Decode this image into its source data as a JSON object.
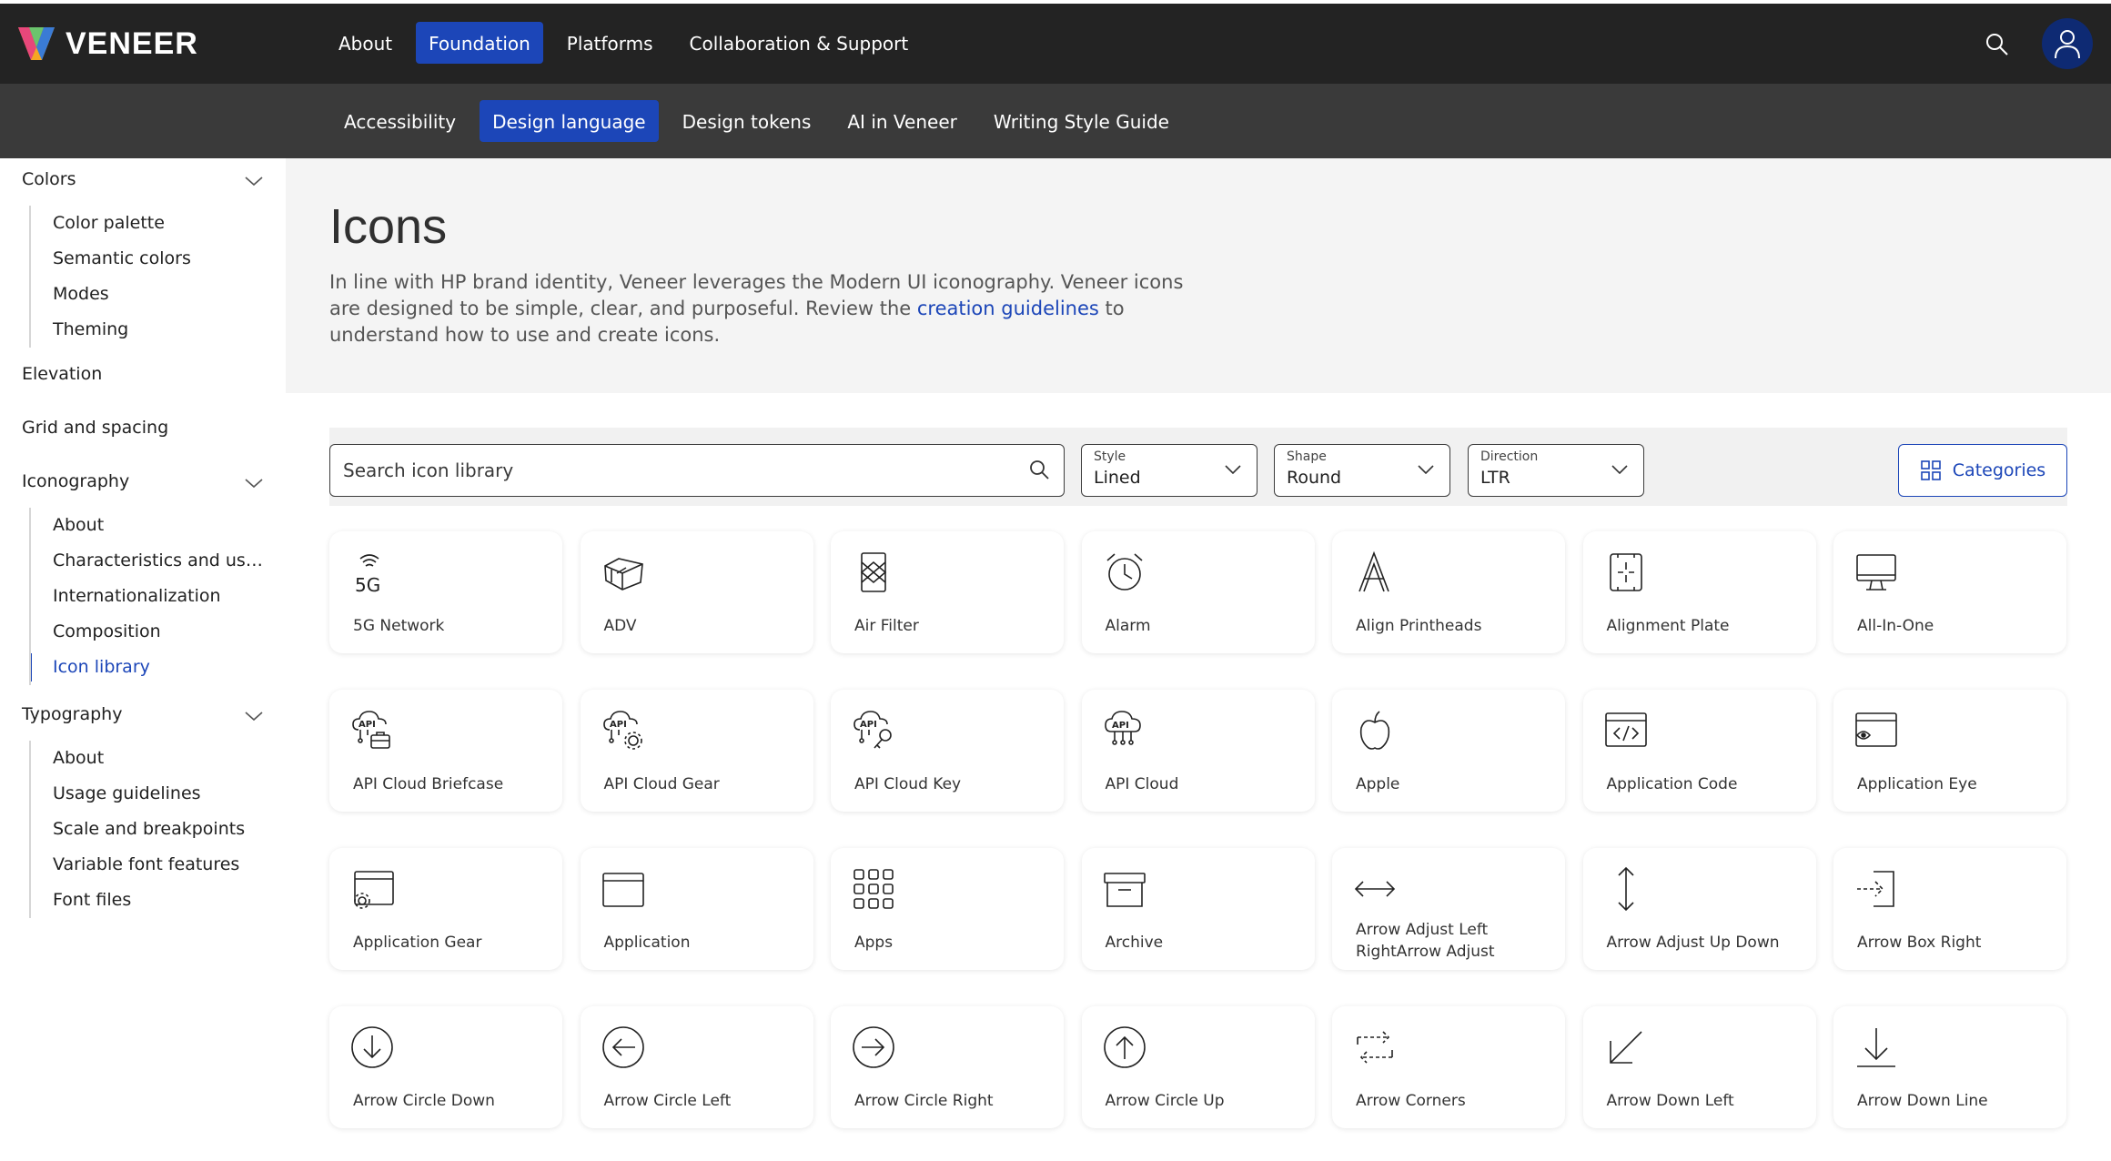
{
  "brand": {
    "name": "VENEER"
  },
  "main_nav": [
    {
      "label": "About",
      "active": false
    },
    {
      "label": "Foundation",
      "active": true
    },
    {
      "label": "Platforms",
      "active": false
    },
    {
      "label": "Collaboration & Support",
      "active": false
    }
  ],
  "sub_nav": [
    {
      "label": "Accessibility",
      "active": false
    },
    {
      "label": "Design language",
      "active": true
    },
    {
      "label": "Design tokens",
      "active": false
    },
    {
      "label": "AI in Veneer",
      "active": false
    },
    {
      "label": "Writing Style Guide",
      "active": false
    }
  ],
  "sidebar": {
    "colors": {
      "label": "Colors",
      "items": [
        "Color palette",
        "Semantic colors",
        "Modes",
        "Theming"
      ]
    },
    "elevation": {
      "label": "Elevation"
    },
    "grid": {
      "label": "Grid and spacing"
    },
    "iconography": {
      "label": "Iconography",
      "items": [
        "About",
        "Characteristics and usage",
        "Internationalization",
        "Composition",
        "Icon library"
      ],
      "active_item": "Icon library"
    },
    "typography": {
      "label": "Typography",
      "items": [
        "About",
        "Usage guidelines",
        "Scale and breakpoints",
        "Variable font features",
        "Font files"
      ]
    }
  },
  "page": {
    "title": "Icons",
    "desc_before": "In line with HP brand identity, Veneer leverages the Modern UI iconography. Veneer icons are designed to be simple, clear, and purposeful. Review the ",
    "desc_link": "creation guidelines",
    "desc_after": " to understand how to use and create icons."
  },
  "toolbar": {
    "search_placeholder": "Search icon library",
    "style": {
      "label": "Style",
      "value": "Lined"
    },
    "shape": {
      "label": "Shape",
      "value": "Round"
    },
    "direction": {
      "label": "Direction",
      "value": "LTR"
    },
    "categories_label": "Categories"
  },
  "colors": {
    "topbar": "#232323",
    "subbar": "#3a3a3a",
    "accent": "#1c46b8"
  },
  "icons": [
    {
      "name": "5G Network",
      "icon": "5g-network-icon"
    },
    {
      "name": "ADV",
      "icon": "adv-icon"
    },
    {
      "name": "Air Filter",
      "icon": "air-filter-icon"
    },
    {
      "name": "Alarm",
      "icon": "alarm-icon"
    },
    {
      "name": "Align Printheads",
      "icon": "align-printheads-icon"
    },
    {
      "name": "Alignment Plate",
      "icon": "alignment-plate-icon"
    },
    {
      "name": "All-In-One",
      "icon": "all-in-one-icon"
    },
    {
      "name": "API Cloud Briefcase",
      "icon": "api-cloud-briefcase-icon"
    },
    {
      "name": "API Cloud Gear",
      "icon": "api-cloud-gear-icon"
    },
    {
      "name": "API Cloud Key",
      "icon": "api-cloud-key-icon"
    },
    {
      "name": "API Cloud",
      "icon": "api-cloud-icon"
    },
    {
      "name": "Apple",
      "icon": "apple-icon"
    },
    {
      "name": "Application Code",
      "icon": "application-code-icon"
    },
    {
      "name": "Application Eye",
      "icon": "application-eye-icon"
    },
    {
      "name": "Application Gear",
      "icon": "application-gear-icon"
    },
    {
      "name": "Application",
      "icon": "application-icon"
    },
    {
      "name": "Apps",
      "icon": "apps-icon"
    },
    {
      "name": "Archive",
      "icon": "archive-icon"
    },
    {
      "name": "Arrow Adjust Left RightArrow Adjust",
      "icon": "arrow-adjust-left-right-icon"
    },
    {
      "name": "Arrow Adjust Up Down",
      "icon": "arrow-adjust-up-down-icon"
    },
    {
      "name": "Arrow Box Right",
      "icon": "arrow-box-right-icon"
    },
    {
      "name": "Arrow Circle Down",
      "icon": "arrow-circle-down-icon"
    },
    {
      "name": "Arrow Circle Left",
      "icon": "arrow-circle-left-icon"
    },
    {
      "name": "Arrow Circle Right",
      "icon": "arrow-circle-right-icon"
    },
    {
      "name": "Arrow Circle Up",
      "icon": "arrow-circle-up-icon"
    },
    {
      "name": "Arrow Corners",
      "icon": "arrow-corners-icon"
    },
    {
      "name": "Arrow Down Left",
      "icon": "arrow-down-left-icon"
    },
    {
      "name": "Arrow Down Line",
      "icon": "arrow-down-line-icon"
    }
  ]
}
